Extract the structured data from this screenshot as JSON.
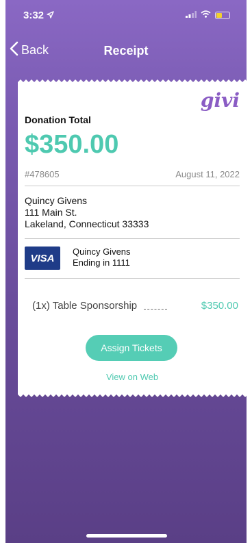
{
  "status": {
    "time": "3:32"
  },
  "nav": {
    "back_label": "Back",
    "title": "Receipt"
  },
  "receipt": {
    "brand": "givi",
    "donation_label": "Donation Total",
    "donation_amount": "$350.00",
    "order_number": "#478605",
    "date": "August 11, 2022",
    "address": [
      "Quincy Givens",
      "111 Main St.",
      "Lakeland, Connecticut 33333"
    ],
    "card": {
      "brand": "VISA",
      "name": "Quincy Givens",
      "ending": "Ending in 1111"
    },
    "line_item": {
      "label": "(1x) Table Sponsorship",
      "price": "$350.00"
    },
    "assign_button": "Assign Tickets",
    "web_link": "View on Web"
  },
  "colors": {
    "accent": "#4ec9b0",
    "brand": "#8a5cc4",
    "background": "#7b5cb3"
  }
}
